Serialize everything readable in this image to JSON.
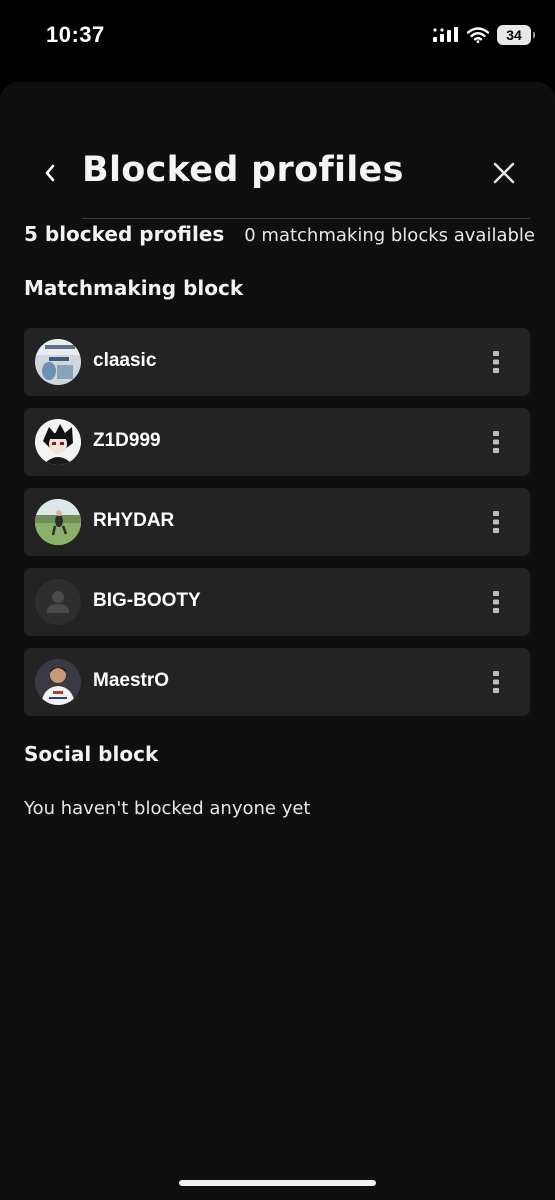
{
  "status_bar": {
    "time": "10:37",
    "battery": "34",
    "icons": [
      "signal-icon",
      "wifi-icon",
      "battery-icon"
    ]
  },
  "header": {
    "title": "Blocked profiles",
    "back_icon": "chevron-left-icon",
    "close_icon": "close-icon"
  },
  "summary": {
    "count_label": "5 blocked profiles",
    "available_label": "0 matchmaking blocks available"
  },
  "matchmaking": {
    "title": "Matchmaking block",
    "items": [
      {
        "name": "claasic",
        "avatar": "photo-avatar"
      },
      {
        "name": "Z1D999",
        "avatar": "anime-avatar"
      },
      {
        "name": "RHYDAR",
        "avatar": "photo-avatar"
      },
      {
        "name": "BIG-BOOTY",
        "avatar": "default-person-avatar"
      },
      {
        "name": "MaestrO",
        "avatar": "photo-avatar"
      }
    ],
    "more_icon": "more-vertical-icon"
  },
  "social": {
    "title": "Social block",
    "empty_text": "You haven't blocked anyone yet"
  },
  "colors": {
    "background": "#000000",
    "sheet": "#0f0f0f",
    "row": "#232323",
    "text": "#ffffff"
  }
}
